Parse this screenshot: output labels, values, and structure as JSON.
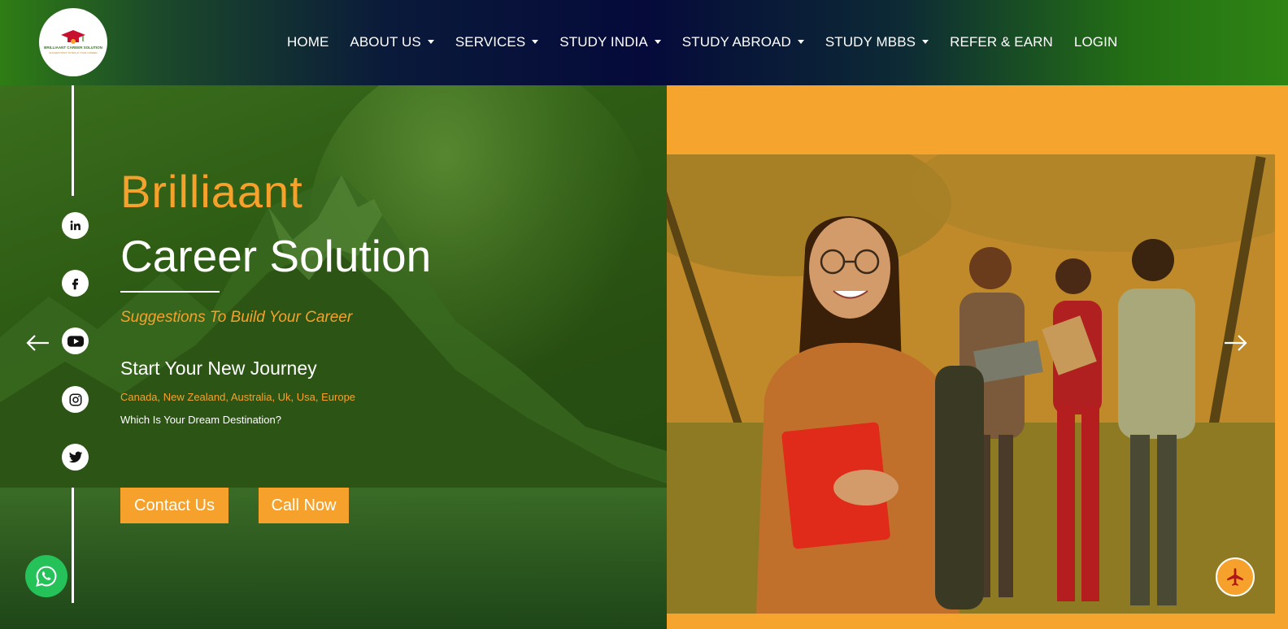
{
  "header": {
    "logo_text": "BRILLIAANT CAREER SOLUTION",
    "logo_tagline": "SUGGESTIONS TO BUILD YOUR CAREER",
    "nav": [
      {
        "label": "HOME",
        "dropdown": false
      },
      {
        "label": "ABOUT US",
        "dropdown": true
      },
      {
        "label": "SERVICES",
        "dropdown": true
      },
      {
        "label": "STUDY INDIA",
        "dropdown": true
      },
      {
        "label": "STUDY ABROAD",
        "dropdown": true
      },
      {
        "label": "STUDY MBBS",
        "dropdown": true
      },
      {
        "label": "REFER & EARN",
        "dropdown": false
      },
      {
        "label": "LOGIN",
        "dropdown": false
      }
    ]
  },
  "hero": {
    "brand": "Brilliaant",
    "title": "Career Solution",
    "tagline": "Suggestions To Build Your Career",
    "journey": "Start Your New Journey",
    "countries": "Canada, New Zealand, Australia, Uk, Usa, Europe",
    "dream": "Which Is Your Dream Destination?",
    "contact_label": "Contact Us",
    "call_label": "Call Now"
  },
  "social": [
    "linkedin-icon",
    "facebook-icon",
    "youtube-icon",
    "instagram-icon",
    "twitter-icon"
  ],
  "colors": {
    "accent": "#f5a12b",
    "header_green": "#2f7d14",
    "header_navy": "#050a3a",
    "hero_green": "#2e5c14",
    "whatsapp": "#25c25a"
  }
}
